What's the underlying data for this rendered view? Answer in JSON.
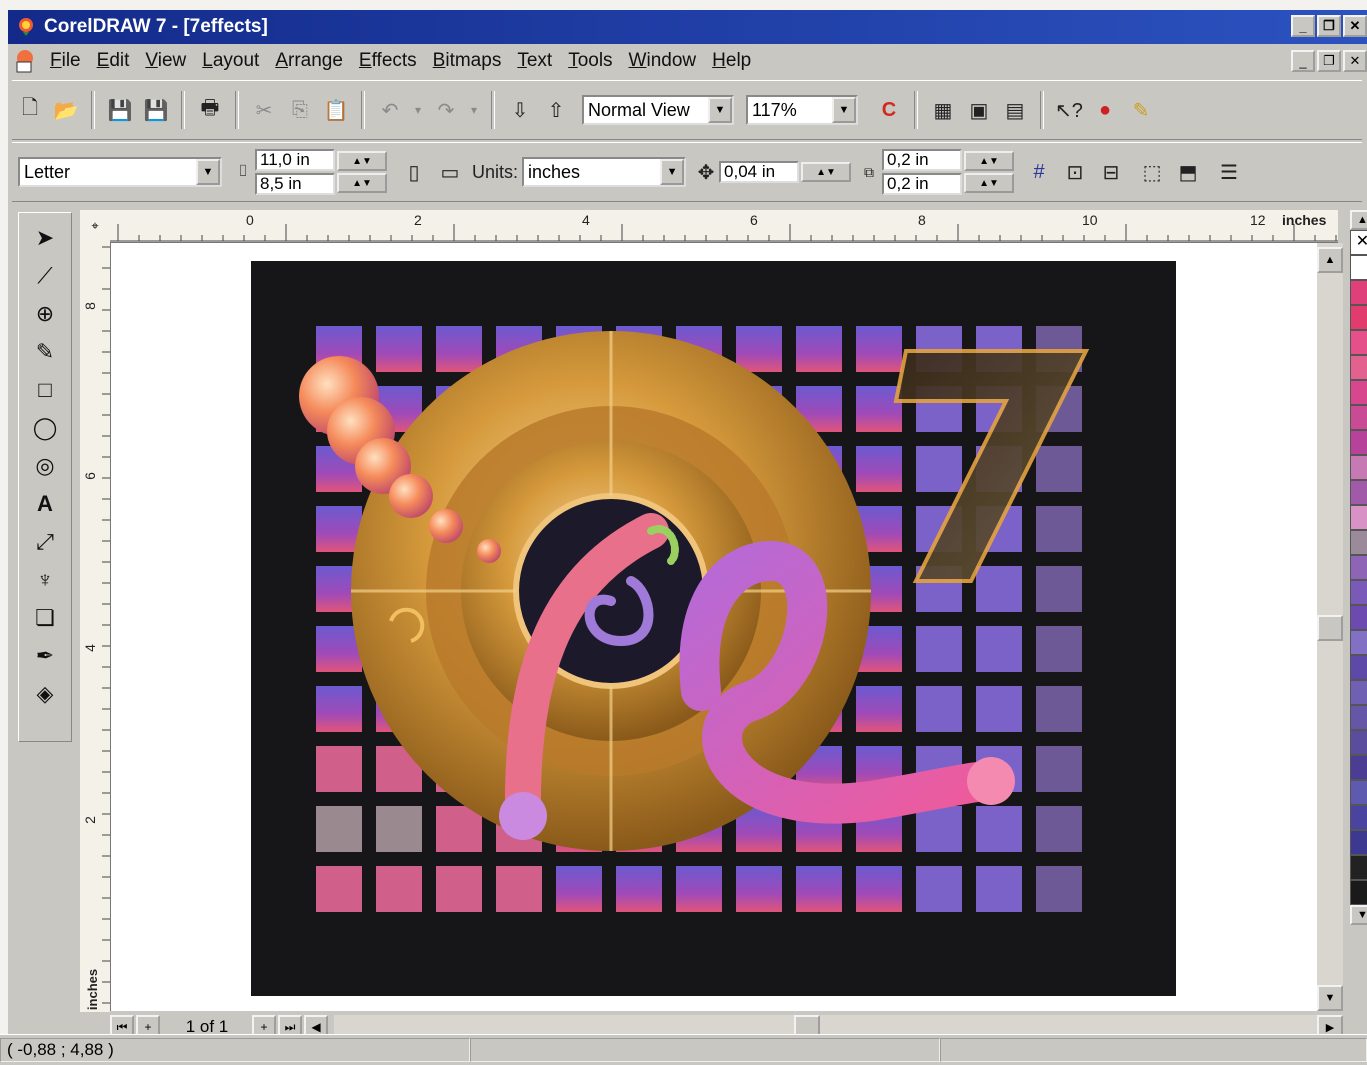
{
  "window": {
    "title": "CorelDRAW 7 - [7effects]",
    "min_btn": "_",
    "max_btn": "❐",
    "close_btn": "✕"
  },
  "menu": [
    "File",
    "Edit",
    "View",
    "Layout",
    "Arrange",
    "Effects",
    "Bitmaps",
    "Text",
    "Tools",
    "Window",
    "Help"
  ],
  "toolbar": {
    "view_mode": "Normal View",
    "zoom": "117%"
  },
  "property_bar": {
    "paper_size": "Letter",
    "width": "11,0 in",
    "height": "8,5 in",
    "units_label": "Units:",
    "units": "inches",
    "nudge": "0,04 in",
    "dup_x": "0,2 in",
    "dup_y": "0,2 in"
  },
  "ruler": {
    "h_ticks": [
      "0",
      "2",
      "4",
      "6",
      "8",
      "10",
      "12"
    ],
    "h_unit": "inches",
    "v_ticks": [
      "8",
      "6",
      "4",
      "2"
    ],
    "v_unit": "inches"
  },
  "artwork": {
    "number": "7"
  },
  "page_nav": {
    "count": "1 of 1"
  },
  "status": {
    "coords": "( -0,88 ; 4,88  )"
  },
  "colors": {
    "titlebar": "#1f3fa8",
    "chrome": "#c9c7c2",
    "art_bg": "#161618",
    "tile": "#8a55c8",
    "gold": "#d69a3c",
    "pink": "#e0559a"
  },
  "palette": [
    "#ffffff",
    "#e0407a",
    "#e23b6e",
    "#e5508a",
    "#e2618f",
    "#d8468e",
    "#c94a95",
    "#b64399",
    "#c779b3",
    "#a05aa8",
    "#d892c6",
    "#9a8a9a",
    "#8e65b6",
    "#7a5ab8",
    "#6c4ab0",
    "#8270c4",
    "#5d4aa8",
    "#7060b4",
    "#6656a8",
    "#5a4d9e",
    "#4c3d94",
    "#5d5ab0",
    "#4a44a0",
    "#3d3990",
    "#222222",
    "#1a1a1a"
  ]
}
